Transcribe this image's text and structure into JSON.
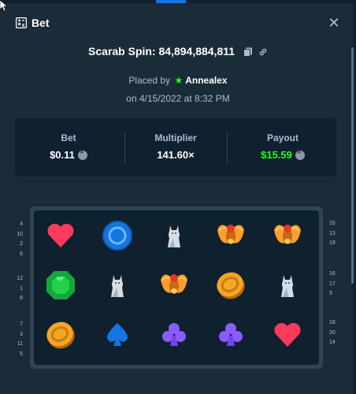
{
  "window": {
    "title": "Bet",
    "close_label": "✕"
  },
  "bet": {
    "spin_label": "Scarab Spin: 84,894,884,811",
    "placed_prefix": "Placed by",
    "user": "Annealex",
    "date": "on 4/15/2022 at 8:32 PM"
  },
  "stats": {
    "bet_label": "Bet",
    "bet_value": "$0.11",
    "multiplier_label": "Multiplier",
    "multiplier_value": "141.60×",
    "payout_label": "Payout",
    "payout_value": "$15.59"
  },
  "board": {
    "rows": [
      [
        "heart",
        "blue-ring",
        "cat-statue",
        "scarab",
        "scarab"
      ],
      [
        "green-gem",
        "cat-statue",
        "scarab",
        "gold-coin",
        "cat-statue"
      ],
      [
        "gold-coin",
        "spade",
        "club",
        "club",
        "heart"
      ]
    ],
    "left_numbers": [
      [
        "4",
        "10",
        "2",
        "6"
      ],
      [
        "12",
        "1",
        "8"
      ],
      [
        "7",
        "3",
        "11",
        "5"
      ]
    ],
    "right_numbers": [
      [
        "15",
        "13",
        "19"
      ],
      [
        "16",
        "17",
        "9"
      ],
      [
        "18",
        "20",
        "14"
      ]
    ]
  },
  "colors": {
    "background": "#1a2c38",
    "panel": "#0f212e",
    "muted_text": "#b1bad3",
    "payout_green": "#1fff20"
  }
}
